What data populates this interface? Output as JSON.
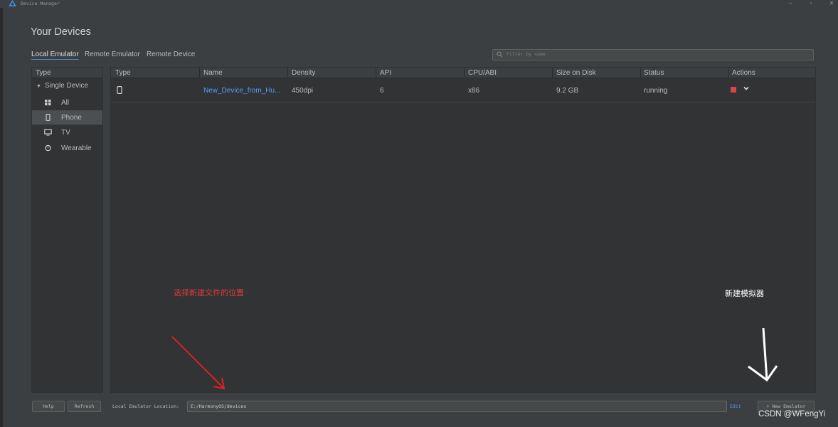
{
  "window": {
    "title": "Device Manager",
    "buttons": [
      "–",
      "▫",
      "✕"
    ]
  },
  "page_title": "Your Devices",
  "tabs": [
    "Local Emulator",
    "Remote Emulator",
    "Remote Device"
  ],
  "filter": {
    "placeholder": "Filter by name"
  },
  "sidebar": {
    "header": "Type",
    "group": "Single Device",
    "items": [
      {
        "label": "All",
        "icon": "grid-icon"
      },
      {
        "label": "Phone",
        "icon": "phone-icon",
        "selected": true
      },
      {
        "label": "TV",
        "icon": "tv-icon"
      },
      {
        "label": "Wearable",
        "icon": "watch-icon"
      }
    ]
  },
  "table": {
    "columns": [
      "Type",
      "Name",
      "Density",
      "API",
      "CPU/ABI",
      "Size on Disk",
      "Status",
      "Actions"
    ],
    "rows": [
      {
        "type_icon": "phone-icon",
        "name": "New_Device_from_Hu...",
        "density": "450dpi",
        "api": "6",
        "cpu": "x86",
        "size": "9.2 GB",
        "status": "running"
      }
    ]
  },
  "bottom": {
    "help": "Help",
    "refresh": "Refresh",
    "location_label": "Local Emulator Location:",
    "location_value": "E:/HarmonyOS/devices",
    "edit": "Edit",
    "new_emulator": "+ New Emulator"
  },
  "annotations": {
    "left_note": "选择新建文件的位置",
    "right_note": "新建模拟器"
  },
  "watermark": "CSDN @WFengYi",
  "colors": {
    "accent": "#589df6",
    "stop": "#e04343",
    "note_red": "#e03a3a"
  }
}
